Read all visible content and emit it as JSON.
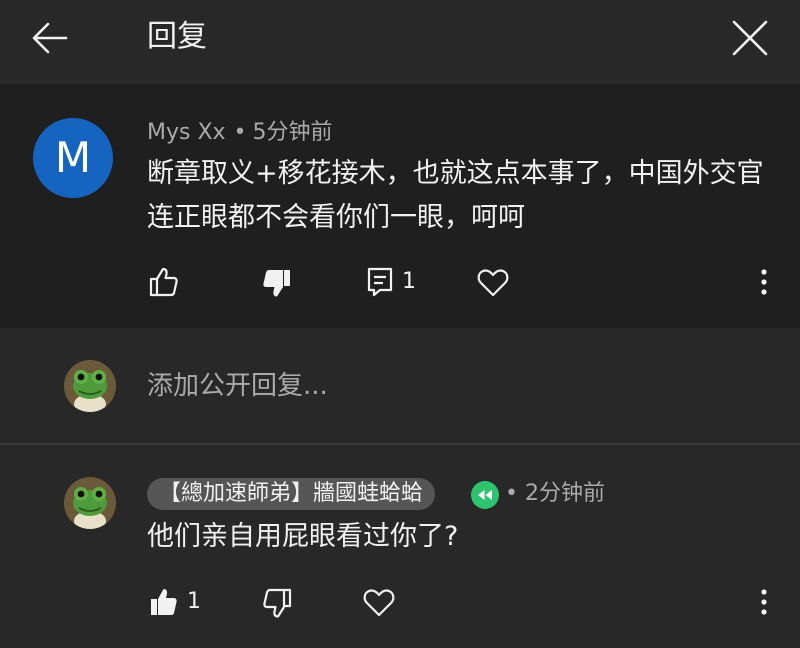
{
  "header": {
    "title": "回复",
    "back_icon": "arrow-left-icon",
    "close_icon": "close-icon"
  },
  "parent_comment": {
    "avatar_letter": "M",
    "avatar_color": "#1565c0",
    "author": "Mys Xx",
    "separator": "•",
    "time": "5分钟前",
    "text": "断章取义+移花接木，也就这点本事了，中国外交官连正眼都不会看你们一眼，呵呵",
    "reply_count": "1"
  },
  "reply_input": {
    "placeholder": "添加公开回复..."
  },
  "reply_comment": {
    "author": "【總加速師弟】牆國蛙蛤蛤",
    "badge_icon": "rewind-badge-icon",
    "badge_color": "#2ec46f",
    "separator": "•",
    "time": "2分钟前",
    "text": "他们亲自用屁眼看过你了?",
    "like_count": "1"
  },
  "colors": {
    "background": "#282828",
    "parent_background": "#1f1f1f",
    "text_primary": "#f1f1f1",
    "text_secondary": "#aaaaaa",
    "chip": "#555555"
  }
}
